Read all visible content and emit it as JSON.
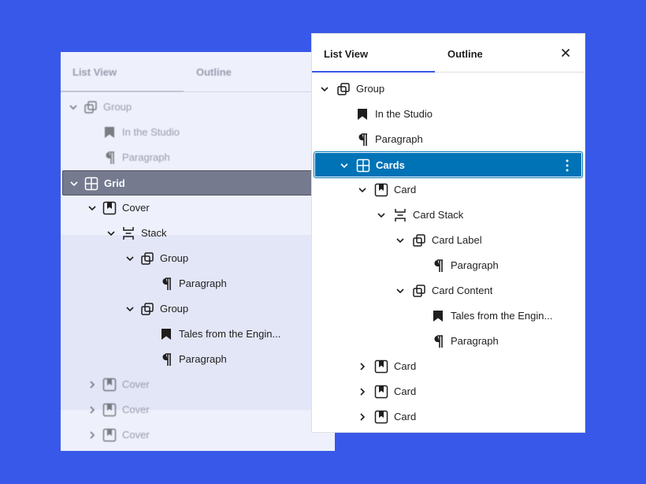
{
  "back_panel": {
    "tabs": [
      "List View",
      "Outline"
    ],
    "rows": [
      {
        "label": "Group",
        "icon": "group-icon",
        "chevron": "down",
        "faded": true
      },
      {
        "label": "In the Studio",
        "icon": "bookmark-icon",
        "chevron": "none",
        "faded": true
      },
      {
        "label": "Paragraph",
        "icon": "paragraph-icon",
        "chevron": "none",
        "faded": true
      },
      {
        "label": "Grid",
        "icon": "grid-icon",
        "chevron": "down",
        "selected": true
      },
      {
        "label": "Cover",
        "icon": "cover-icon",
        "chevron": "down"
      },
      {
        "label": "Stack",
        "icon": "stack-icon",
        "chevron": "down"
      },
      {
        "label": "Group",
        "icon": "group-icon",
        "chevron": "down"
      },
      {
        "label": "Paragraph",
        "icon": "paragraph-icon",
        "chevron": "none"
      },
      {
        "label": "Group",
        "icon": "group-icon",
        "chevron": "down"
      },
      {
        "label": "Tales from the Engin...",
        "icon": "bookmark-icon",
        "chevron": "none"
      },
      {
        "label": "Paragraph",
        "icon": "paragraph-icon",
        "chevron": "none"
      },
      {
        "label": "Cover",
        "icon": "cover-icon",
        "chevron": "right",
        "faded": true
      },
      {
        "label": "Cover",
        "icon": "cover-icon",
        "chevron": "right",
        "faded": true
      },
      {
        "label": "Cover",
        "icon": "cover-icon",
        "chevron": "right",
        "faded": true
      }
    ]
  },
  "front_panel": {
    "tabs": [
      "List View",
      "Outline"
    ],
    "close_label": "close",
    "rows": [
      {
        "label": "Group",
        "icon": "group-icon",
        "chevron": "down"
      },
      {
        "label": "In the Studio",
        "icon": "bookmark-icon",
        "chevron": "none"
      },
      {
        "label": "Paragraph",
        "icon": "paragraph-icon",
        "chevron": "none"
      },
      {
        "label": "Cards",
        "icon": "grid-icon",
        "chevron": "down",
        "selected": true
      },
      {
        "label": "Card",
        "icon": "cover-icon",
        "chevron": "down"
      },
      {
        "label": "Card Stack",
        "icon": "stack-icon",
        "chevron": "down"
      },
      {
        "label": "Card Label",
        "icon": "group-icon",
        "chevron": "down"
      },
      {
        "label": "Paragraph",
        "icon": "paragraph-icon",
        "chevron": "none"
      },
      {
        "label": "Card Content",
        "icon": "group-icon",
        "chevron": "down"
      },
      {
        "label": "Tales from the Engin...",
        "icon": "bookmark-icon",
        "chevron": "none"
      },
      {
        "label": "Paragraph",
        "icon": "paragraph-icon",
        "chevron": "none"
      },
      {
        "label": "Card",
        "icon": "cover-icon",
        "chevron": "right"
      },
      {
        "label": "Card",
        "icon": "cover-icon",
        "chevron": "right"
      },
      {
        "label": "Card",
        "icon": "cover-icon",
        "chevron": "right"
      }
    ]
  },
  "colors": {
    "background": "#3858e9",
    "selected_front": "#0073b7",
    "selected_back": "#757a8f"
  }
}
